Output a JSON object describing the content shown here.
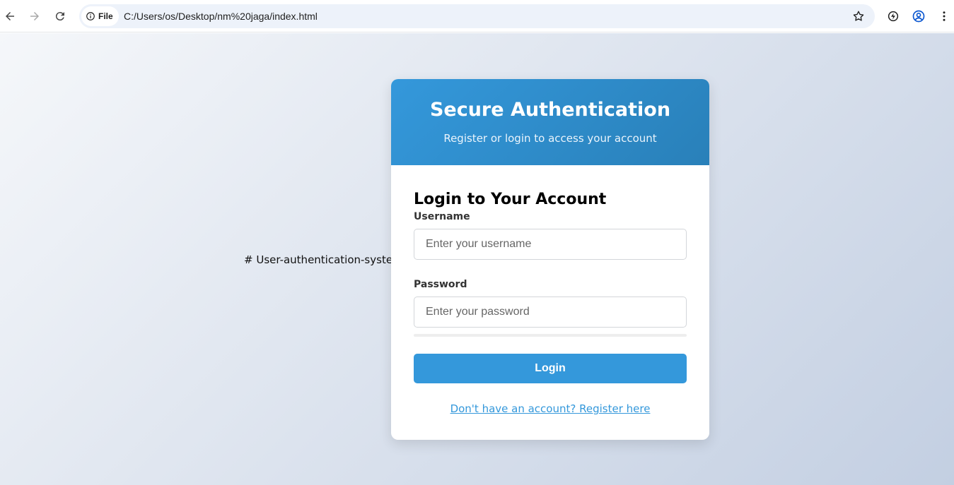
{
  "browser": {
    "chip_label": "File",
    "url": "C:/Users/os/Desktop/nm%20jaga/index.html",
    "icons": [
      "back-icon",
      "forward-icon",
      "reload-icon",
      "info-icon",
      "star-icon",
      "extension-icon",
      "profile-icon",
      "menu-icon"
    ]
  },
  "page": {
    "readme_text": "# User-authentication-system",
    "header": {
      "title": "Secure Authentication",
      "subtitle": "Register or login to access your account"
    },
    "form": {
      "title": "Login to Your Account",
      "username_label": "Username",
      "username_placeholder": "Enter your username",
      "username_value": "",
      "password_label": "Password",
      "password_placeholder": "Enter your password",
      "password_value": "",
      "submit_label": "Login",
      "switch_link": "Don't have an account? Register here"
    }
  },
  "colors": {
    "accent": "#3498db",
    "accent_dark": "#2980b9",
    "page_gradient_start": "#f5f7fa",
    "page_gradient_end": "#c3cfe2"
  }
}
